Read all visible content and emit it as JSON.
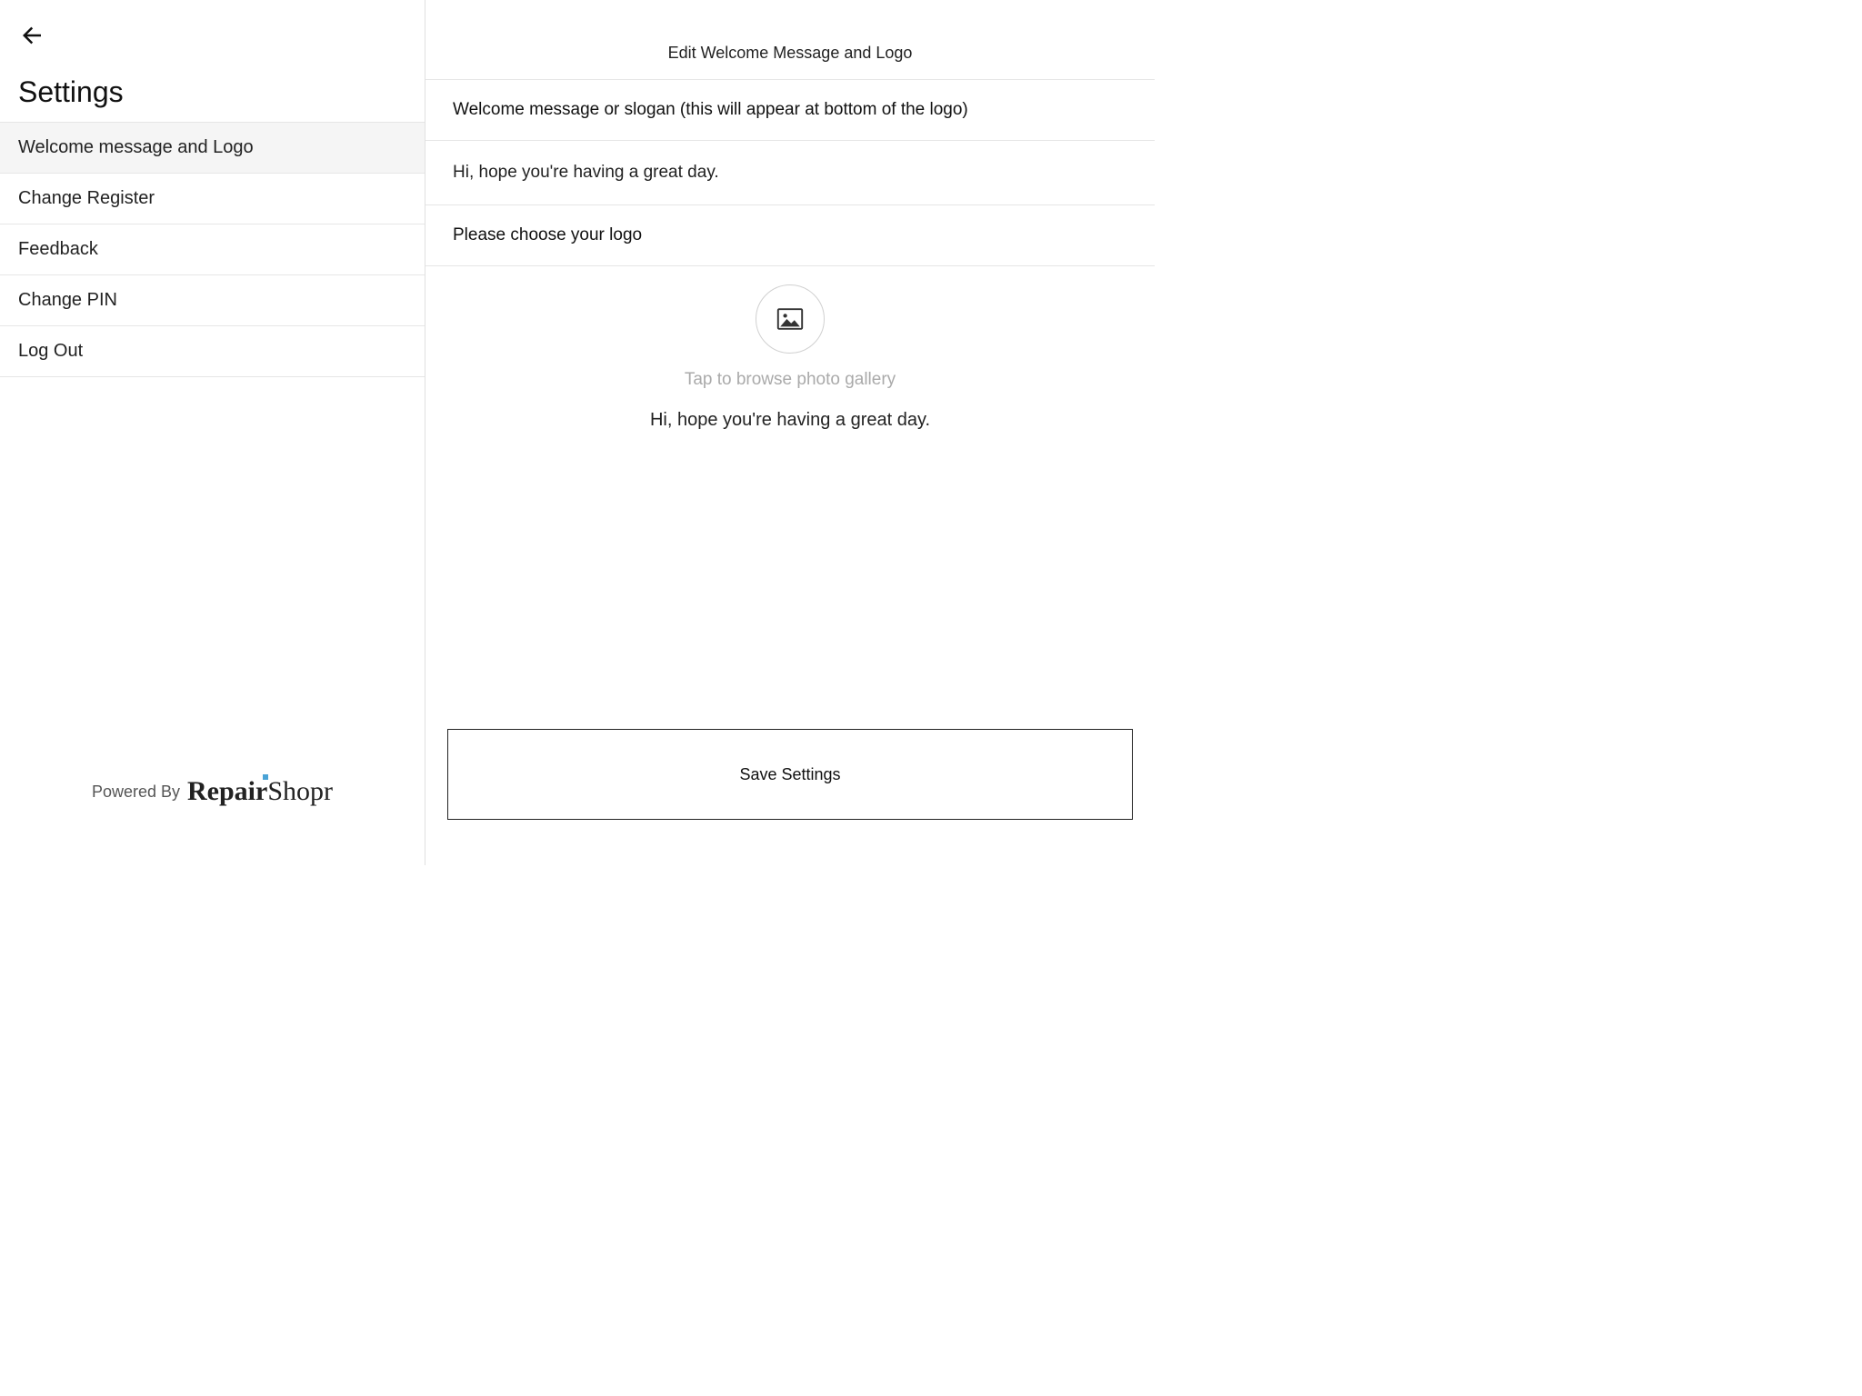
{
  "sidebar": {
    "title": "Settings",
    "items": [
      {
        "label": "Welcome message and Logo"
      },
      {
        "label": "Change Register"
      },
      {
        "label": "Feedback"
      },
      {
        "label": "Change PIN"
      },
      {
        "label": "Log Out"
      }
    ],
    "powered_by": "Powered By",
    "brand_repair": "Repair",
    "brand_shopr": "Shopr"
  },
  "main": {
    "header": "Edit Welcome Message and Logo",
    "welcome_section_title": "Welcome message or slogan (this will appear at bottom of the logo)",
    "welcome_input_value": "Hi, hope you're having a great day.",
    "logo_section_title": "Please choose your logo",
    "tap_hint": "Tap to browse photo gallery",
    "preview_text": "Hi, hope you're having a great day.",
    "save_button": "Save Settings"
  }
}
